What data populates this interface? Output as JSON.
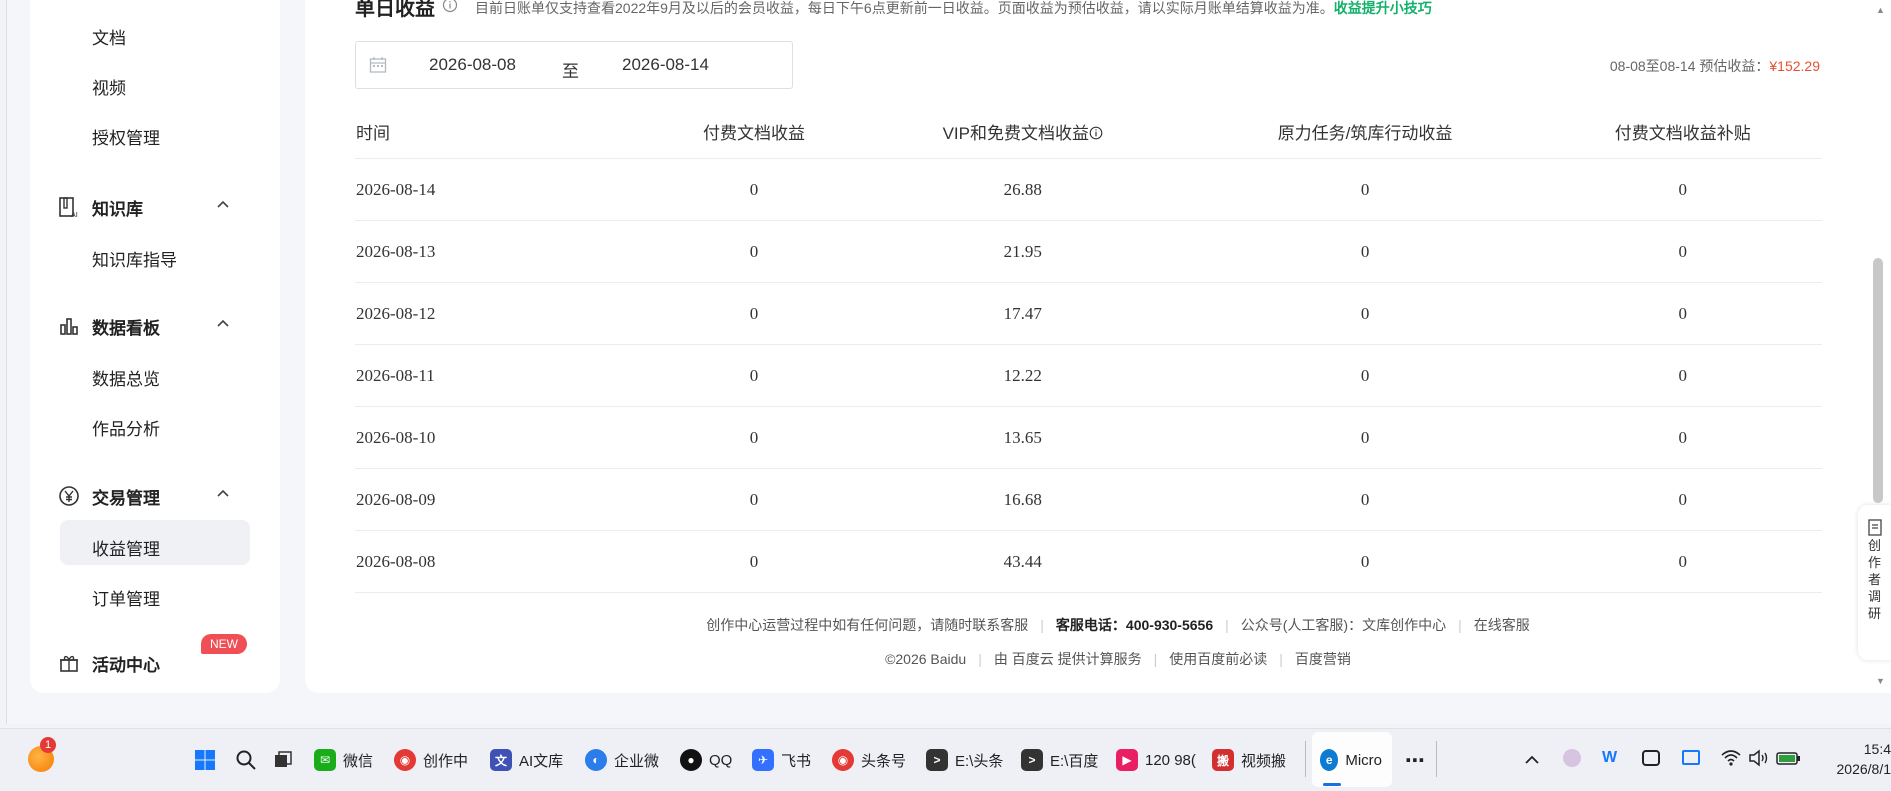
{
  "sidebar": {
    "sub_items_top": [
      "文档",
      "视频",
      "授权管理"
    ],
    "groups": [
      {
        "label": "知识库",
        "icon": "knowledge-base-icon",
        "items": [
          "知识库指导"
        ]
      },
      {
        "label": "数据看板",
        "icon": "bar-chart-icon",
        "items": [
          "数据总览",
          "作品分析"
        ]
      },
      {
        "label": "交易管理",
        "icon": "yuan-icon",
        "items": [
          "收益管理",
          "订单管理"
        ]
      },
      {
        "label": "活动中心",
        "icon": "gift-icon",
        "badge": "NEW"
      }
    ],
    "active_item": "收益管理"
  },
  "section": {
    "title": "单日收益",
    "note": "目前日账单仅支持查看2022年9月及以后的会员收益，每日下午6点更新前一日收益。页面收益为预估收益，请以实际月账单结算收益为准。",
    "tips_link": "收益提升小技巧"
  },
  "date_range": {
    "start": "2026-08-08",
    "separator": "至",
    "end": "2026-08-14"
  },
  "summary": {
    "label": "08-08至08-14 预估收益：",
    "amount": "¥152.29"
  },
  "table": {
    "headers": [
      "时间",
      "付费文档收益",
      "VIP和免费文档收益",
      "原力任务/筑库行动收益",
      "付费文档收益补贴"
    ],
    "rows": [
      [
        "2026-08-14",
        "0",
        "26.88",
        "0",
        "0"
      ],
      [
        "2026-08-13",
        "0",
        "21.95",
        "0",
        "0"
      ],
      [
        "2026-08-12",
        "0",
        "17.47",
        "0",
        "0"
      ],
      [
        "2026-08-11",
        "0",
        "12.22",
        "0",
        "0"
      ],
      [
        "2026-08-10",
        "0",
        "13.65",
        "0",
        "0"
      ],
      [
        "2026-08-09",
        "0",
        "16.68",
        "0",
        "0"
      ],
      [
        "2026-08-08",
        "0",
        "43.44",
        "0",
        "0"
      ]
    ]
  },
  "footer": {
    "line1": {
      "contact": "创作中心运营过程中如有任何问题，请随时联系客服",
      "phone": "客服电话：400-930-5656",
      "wechat": "公众号(人工客服)：文库创作中心",
      "online": "在线客服"
    },
    "line2": {
      "copyright": "©2026 Baidu",
      "cloud": "由 百度云 提供计算服务",
      "must_read": "使用百度前必读",
      "marketing": "百度营销"
    }
  },
  "float_card": {
    "chars": [
      "创",
      "作",
      "者",
      "调",
      "研"
    ]
  },
  "taskbar": {
    "notification_count": "1",
    "items": [
      {
        "label": "微信",
        "color": "#1aad19"
      },
      {
        "label": "创作中",
        "color": "#e53935"
      },
      {
        "label": "AI文库",
        "color": "#3f51b5"
      },
      {
        "label": "企业微",
        "color": "#2b7de9"
      },
      {
        "label": "QQ",
        "color": "#111111"
      },
      {
        "label": "飞书",
        "color": "#3370ff"
      },
      {
        "label": "头条号",
        "color": "#e53935"
      },
      {
        "label": "E:\\头条",
        "color": "#333333"
      },
      {
        "label": "E:\\百度",
        "color": "#333333"
      },
      {
        "label": "120 98(",
        "color": "#e91e63"
      },
      {
        "label": "视频搬",
        "color": "#d32f2f"
      },
      {
        "label": "Micro",
        "color": "#0c7bd1"
      }
    ],
    "clock_time": "15:4",
    "clock_date": "2026/8/1"
  }
}
